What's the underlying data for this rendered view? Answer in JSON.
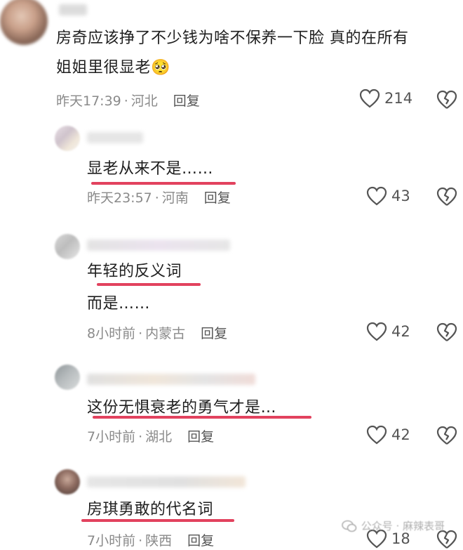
{
  "comments": [
    {
      "text_line1": "房奇应该挣了不少钱为啥不保养一下脸 真的在所有",
      "text_line2": "姐姐里很显老",
      "emoji": "🥺",
      "time": "昨天17:39",
      "location": "河北",
      "reply_label": "回复",
      "likes": "214"
    },
    {
      "text_line1": "显老从来不是……",
      "time": "昨天23:57",
      "location": "河南",
      "reply_label": "回复",
      "likes": "43"
    },
    {
      "text_line1": "年轻的反义词",
      "text_line2": "而是……",
      "time": "8小时前",
      "location": "内蒙古",
      "reply_label": "回复",
      "likes": "42"
    },
    {
      "text_line1": "这份无惧衰老的勇气才是…",
      "time": "7小时前",
      "location": "湖北",
      "reply_label": "回复",
      "likes": "42"
    },
    {
      "text_line1": "房琪勇敢的代名词",
      "time": "7小时前",
      "location": "陕西",
      "reply_label": "回复",
      "likes": "18"
    }
  ],
  "watermark": {
    "text": "公众号 · 麻辣表哥",
    "icon": "wechat-icon"
  },
  "colors": {
    "underline": "#e2425e",
    "meta": "#8a8a8a",
    "icon": "#555555"
  }
}
